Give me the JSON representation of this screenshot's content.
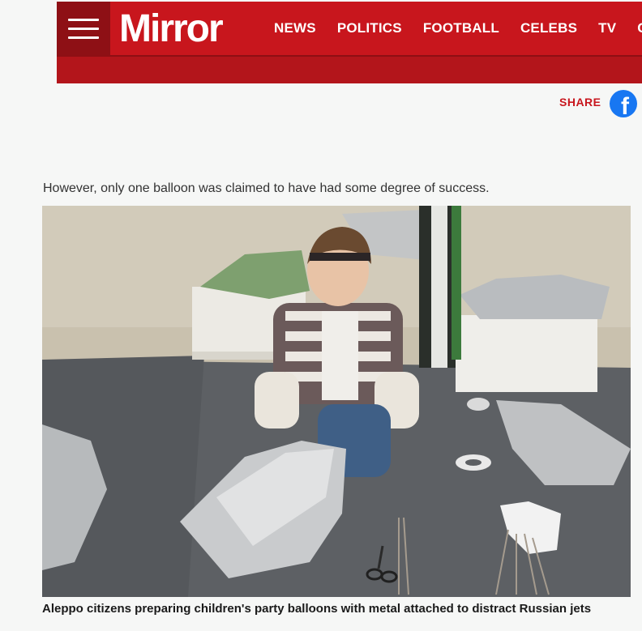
{
  "header": {
    "logo": "Mirror",
    "nav": [
      "NEWS",
      "POLITICS",
      "FOOTBALL",
      "CELEBS",
      "TV",
      "CH"
    ]
  },
  "share": {
    "label": "SHARE",
    "icon": "facebook-icon"
  },
  "article": {
    "paragraph": "However, only one balloon was claimed to have had some degree of success.",
    "caption": "Aleppo citizens preparing children's party balloons with metal attached to distract Russian jets"
  },
  "colors": {
    "brand": "#c8161d",
    "facebook": "#1877f2"
  }
}
